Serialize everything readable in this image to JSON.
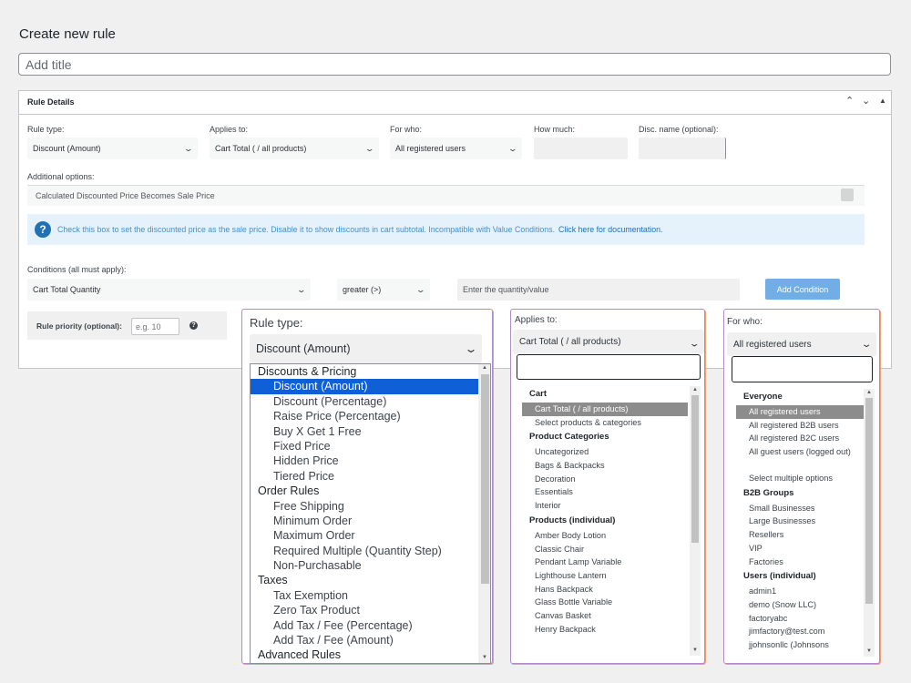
{
  "page_title": "Create new rule",
  "title_placeholder": "Add title",
  "panel": {
    "title": "Rule Details",
    "controls": [
      "^",
      "v",
      "▲"
    ]
  },
  "form": {
    "rule_type": {
      "label": "Rule type:",
      "value": "Discount (Amount)"
    },
    "applies_to": {
      "label": "Applies to:",
      "value": "Cart Total ( / all products)"
    },
    "for_who": {
      "label": "For who:",
      "value": "All registered users"
    },
    "how_much": {
      "label": "How much:"
    },
    "disc_name": {
      "label": "Disc. name (optional):"
    },
    "additional_options_label": "Additional options:",
    "option_text": "Calculated Discounted Price Becomes Sale Price",
    "info_text": "Check this box to set the discounted price as the sale price. Disable it to show discounts in cart subtotal. Incompatible with Value Conditions.",
    "info_link": "Click here for documentation.",
    "conditions_label": "Conditions (all must apply):",
    "condition_field": "Cart Total Quantity",
    "condition_operator": "greater (>)",
    "condition_value_placeholder": "Enter the quantity/value",
    "add_condition_button": "Add Condition",
    "priority_label": "Rule priority (optional):",
    "priority_placeholder": "e.g. 10",
    "info_icon": "question-icon",
    "help_icon": "help-icon"
  },
  "overlay_rule_type": {
    "label": "Rule type:",
    "value": "Discount (Amount)",
    "options": [
      {
        "type": "group",
        "label": "Discounts & Pricing"
      },
      {
        "type": "item",
        "label": "Discount (Amount)",
        "selected": true
      },
      {
        "type": "item",
        "label": "Discount (Percentage)"
      },
      {
        "type": "item",
        "label": "Raise Price (Percentage)"
      },
      {
        "type": "item",
        "label": "Buy X Get 1 Free"
      },
      {
        "type": "item",
        "label": "Fixed Price"
      },
      {
        "type": "item",
        "label": "Hidden Price"
      },
      {
        "type": "item",
        "label": "Tiered Price"
      },
      {
        "type": "group",
        "label": "Order Rules"
      },
      {
        "type": "item",
        "label": "Free Shipping"
      },
      {
        "type": "item",
        "label": "Minimum Order"
      },
      {
        "type": "item",
        "label": "Maximum Order"
      },
      {
        "type": "item",
        "label": "Required Multiple (Quantity Step)"
      },
      {
        "type": "item",
        "label": "Non-Purchasable"
      },
      {
        "type": "group",
        "label": "Taxes"
      },
      {
        "type": "item",
        "label": "Tax Exemption"
      },
      {
        "type": "item",
        "label": "Zero Tax Product"
      },
      {
        "type": "item",
        "label": "Add Tax / Fee (Percentage)"
      },
      {
        "type": "item",
        "label": "Add Tax / Fee (Amount)"
      },
      {
        "type": "group",
        "label": "Advanced Rules"
      }
    ]
  },
  "overlay_applies_to": {
    "label": "Applies to:",
    "value": "Cart Total ( / all products)",
    "options": [
      {
        "type": "group",
        "label": "Cart"
      },
      {
        "type": "item",
        "label": "Cart Total ( / all products)",
        "highlighted": true
      },
      {
        "type": "item",
        "label": "Select products & categories"
      },
      {
        "type": "group",
        "label": "Product Categories"
      },
      {
        "type": "item",
        "label": "Uncategorized"
      },
      {
        "type": "item",
        "label": "Bags & Backpacks"
      },
      {
        "type": "item",
        "label": "Decoration"
      },
      {
        "type": "item",
        "label": "Essentials"
      },
      {
        "type": "item",
        "label": "Interior"
      },
      {
        "type": "group",
        "label": "Products (individual)"
      },
      {
        "type": "item",
        "label": "Amber Body Lotion"
      },
      {
        "type": "item",
        "label": "Classic Chair"
      },
      {
        "type": "item",
        "label": "Pendant Lamp Variable"
      },
      {
        "type": "item",
        "label": "Lighthouse Lantern"
      },
      {
        "type": "item",
        "label": "Hans Backpack"
      },
      {
        "type": "item",
        "label": "Glass Bottle Variable"
      },
      {
        "type": "item",
        "label": "Canvas Basket"
      },
      {
        "type": "item",
        "label": "Henry Backpack"
      }
    ]
  },
  "overlay_for_who": {
    "label": "For who:",
    "value": "All registered users",
    "options": [
      {
        "type": "group",
        "label": "Everyone"
      },
      {
        "type": "item",
        "label": "All registered users",
        "highlighted": true
      },
      {
        "type": "item",
        "label": "All registered B2B users"
      },
      {
        "type": "item",
        "label": "All registered B2C users"
      },
      {
        "type": "item",
        "label": "All guest users (logged out)",
        "wrap": true
      },
      {
        "type": "item",
        "label": "Select multiple options"
      },
      {
        "type": "group",
        "label": "B2B Groups"
      },
      {
        "type": "item",
        "label": "Small Businesses"
      },
      {
        "type": "item",
        "label": "Large Businesses"
      },
      {
        "type": "item",
        "label": "Resellers"
      },
      {
        "type": "item",
        "label": "VIP"
      },
      {
        "type": "item",
        "label": "Factories"
      },
      {
        "type": "group",
        "label": "Users (individual)"
      },
      {
        "type": "item",
        "label": "admin1"
      },
      {
        "type": "item",
        "label": "demo (Snow LLC)"
      },
      {
        "type": "item",
        "label": "factoryabc"
      },
      {
        "type": "item",
        "label": "jimfactory@test.com"
      },
      {
        "type": "item",
        "label": "jjohnsonllc (Johnsons"
      }
    ]
  }
}
